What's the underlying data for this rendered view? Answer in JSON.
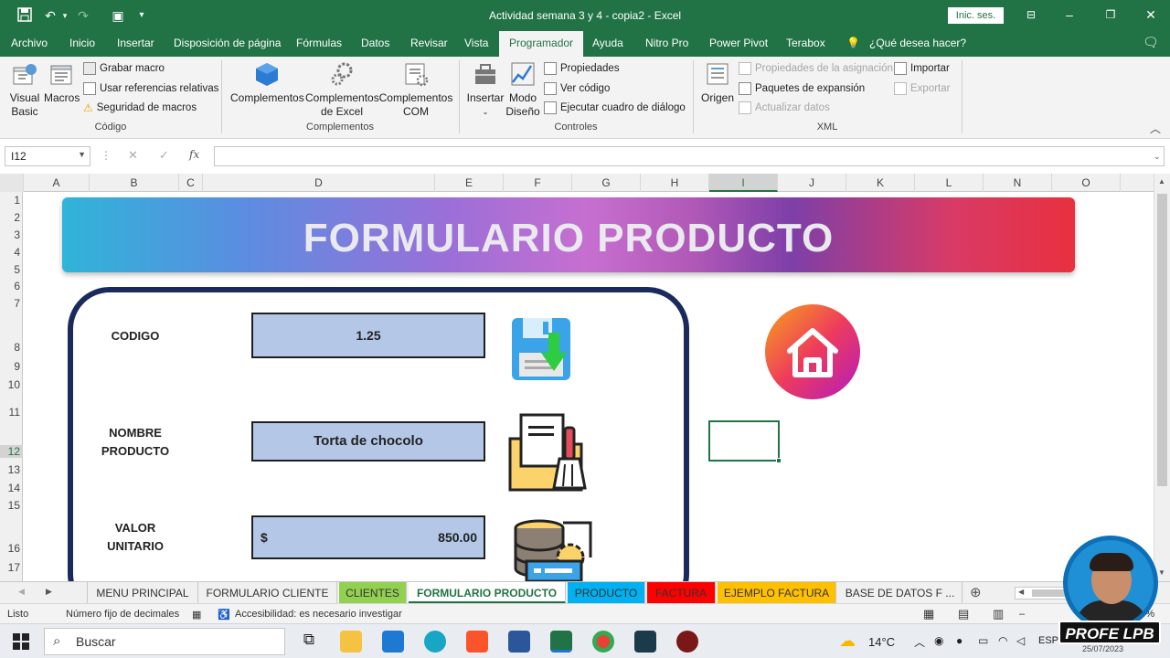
{
  "window": {
    "title": "Actividad semana 3 y 4 - copia2 - Excel",
    "signin_label": "Inic. ses."
  },
  "menu_tabs": [
    "Archivo",
    "Inicio",
    "Insertar",
    "Disposición de página",
    "Fórmulas",
    "Datos",
    "Revisar",
    "Vista",
    "Programador",
    "Ayuda",
    "Nitro Pro",
    "Power Pivot",
    "Terabox",
    "¿Qué desea hacer?"
  ],
  "active_tab": "Programador",
  "ribbon": {
    "codigo": {
      "visual_basic": "Visual Basic",
      "macros": "Macros",
      "grabar_macro": "Grabar macro",
      "usar_ref": "Usar referencias relativas",
      "seguridad": "Seguridad de macros",
      "label": "Código"
    },
    "complementos": {
      "complementos": "Complementos",
      "excel": "Complementos de Excel",
      "com": "Complementos COM",
      "label": "Complementos"
    },
    "controles": {
      "insertar": "Insertar",
      "modo_diseno": "Modo Diseño",
      "propiedades": "Propiedades",
      "ver_codigo": "Ver código",
      "ejecutar": "Ejecutar cuadro de diálogo",
      "label": "Controles"
    },
    "xml": {
      "origen": "Origen",
      "prop_asignacion": "Propiedades de la asignación",
      "paquetes": "Paquetes de expansión",
      "actualizar": "Actualizar datos",
      "importar": "Importar",
      "exportar": "Exportar",
      "label": "XML"
    }
  },
  "formula_bar": {
    "name_box": "I12",
    "fx": "fx"
  },
  "columns": [
    "A",
    "B",
    "C",
    "D",
    "E",
    "F",
    "G",
    "H",
    "I",
    "J",
    "K",
    "L",
    "N",
    "O"
  ],
  "rows": [
    "1",
    "2",
    "3",
    "4",
    "5",
    "6",
    "7",
    "8",
    "9",
    "10",
    "11",
    "12",
    "13",
    "14",
    "15",
    "16",
    "17"
  ],
  "form": {
    "banner_title": "FORMULARIO PRODUCTO",
    "codigo_label": "CODIGO",
    "codigo_value": "1.25",
    "nombre_label_1": "NOMBRE",
    "nombre_label_2": "PRODUCTO",
    "nombre_value": "Torta de chocolo",
    "valor_label_1": "VALOR",
    "valor_label_2": "UNITARIO",
    "valor_currency": "$",
    "valor_value": "850.00"
  },
  "sheet_tabs": [
    {
      "label": "MENU PRINCIPAL",
      "color": ""
    },
    {
      "label": "FORMULARIO CLIENTE",
      "color": ""
    },
    {
      "label": "CLIENTES",
      "color": "#92d050"
    },
    {
      "label": "FORMULARIO PRODUCTO",
      "color": ""
    },
    {
      "label": "PRODUCTO",
      "color": "#00b0f0"
    },
    {
      "label": "FACTURA",
      "color": "#ff0000"
    },
    {
      "label": "EJEMPLO FACTURA",
      "color": "#ffc000"
    },
    {
      "label": "BASE DE DATOS F ...",
      "color": ""
    }
  ],
  "status": {
    "ready": "Listo",
    "fixed_decimal": "Número fijo de decimales",
    "accessibility": "Accesibilidad: es necesario investigar",
    "zoom": "100%"
  },
  "taskbar": {
    "search_placeholder": "Buscar",
    "temperature": "14°C",
    "language": "ESP",
    "date": "25/07/2023"
  },
  "badge_text": "PROFE LPB"
}
